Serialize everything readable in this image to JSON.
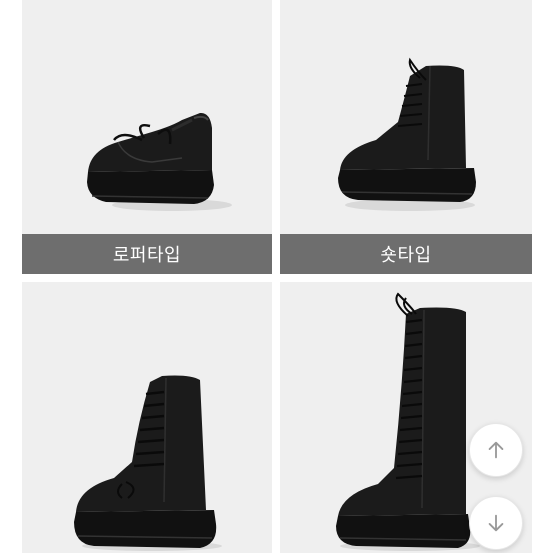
{
  "products": [
    {
      "label": "로퍼타입",
      "image_icon": "loafer-shoe-image"
    },
    {
      "label": "숏타입",
      "image_icon": "short-boot-image"
    },
    {
      "label": "",
      "image_icon": "mid-boot-image"
    },
    {
      "label": "",
      "image_icon": "long-boot-image"
    }
  ],
  "scroll_buttons": {
    "up_icon": "arrow-up-icon",
    "down_icon": "arrow-down-icon"
  },
  "colors": {
    "label_bar": "#6e6e6e",
    "label_text": "#ffffff",
    "photo_bg": "#efefef",
    "shoe": "#1b1b1b",
    "arrow": "#999999"
  }
}
